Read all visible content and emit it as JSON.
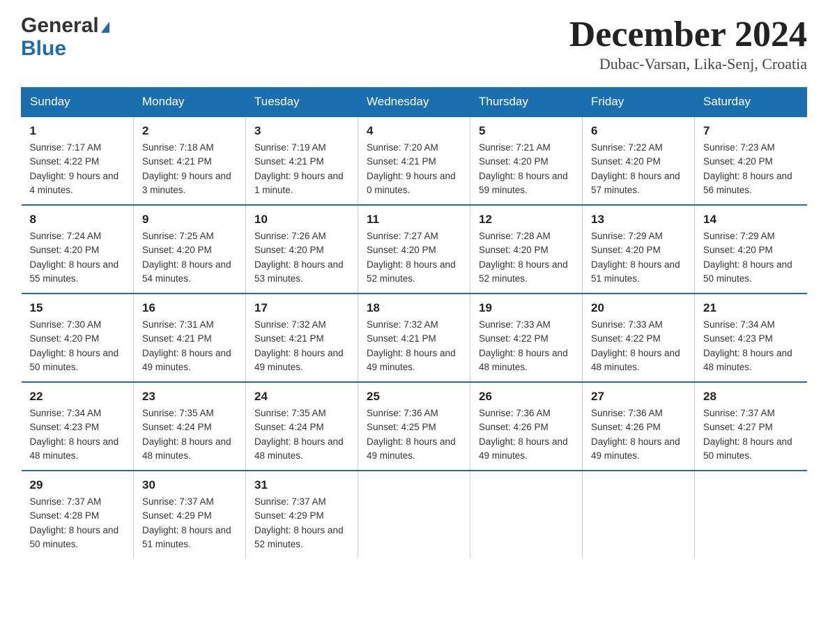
{
  "header": {
    "logo_general": "General",
    "logo_blue": "Blue",
    "title": "December 2024",
    "subtitle": "Dubac-Varsan, Lika-Senj, Croatia"
  },
  "days_of_week": [
    "Sunday",
    "Monday",
    "Tuesday",
    "Wednesday",
    "Thursday",
    "Friday",
    "Saturday"
  ],
  "weeks": [
    [
      {
        "day": "1",
        "sunrise": "7:17 AM",
        "sunset": "4:22 PM",
        "daylight": "9 hours and 4 minutes."
      },
      {
        "day": "2",
        "sunrise": "7:18 AM",
        "sunset": "4:21 PM",
        "daylight": "9 hours and 3 minutes."
      },
      {
        "day": "3",
        "sunrise": "7:19 AM",
        "sunset": "4:21 PM",
        "daylight": "9 hours and 1 minute."
      },
      {
        "day": "4",
        "sunrise": "7:20 AM",
        "sunset": "4:21 PM",
        "daylight": "9 hours and 0 minutes."
      },
      {
        "day": "5",
        "sunrise": "7:21 AM",
        "sunset": "4:20 PM",
        "daylight": "8 hours and 59 minutes."
      },
      {
        "day": "6",
        "sunrise": "7:22 AM",
        "sunset": "4:20 PM",
        "daylight": "8 hours and 57 minutes."
      },
      {
        "day": "7",
        "sunrise": "7:23 AM",
        "sunset": "4:20 PM",
        "daylight": "8 hours and 56 minutes."
      }
    ],
    [
      {
        "day": "8",
        "sunrise": "7:24 AM",
        "sunset": "4:20 PM",
        "daylight": "8 hours and 55 minutes."
      },
      {
        "day": "9",
        "sunrise": "7:25 AM",
        "sunset": "4:20 PM",
        "daylight": "8 hours and 54 minutes."
      },
      {
        "day": "10",
        "sunrise": "7:26 AM",
        "sunset": "4:20 PM",
        "daylight": "8 hours and 53 minutes."
      },
      {
        "day": "11",
        "sunrise": "7:27 AM",
        "sunset": "4:20 PM",
        "daylight": "8 hours and 52 minutes."
      },
      {
        "day": "12",
        "sunrise": "7:28 AM",
        "sunset": "4:20 PM",
        "daylight": "8 hours and 52 minutes."
      },
      {
        "day": "13",
        "sunrise": "7:29 AM",
        "sunset": "4:20 PM",
        "daylight": "8 hours and 51 minutes."
      },
      {
        "day": "14",
        "sunrise": "7:29 AM",
        "sunset": "4:20 PM",
        "daylight": "8 hours and 50 minutes."
      }
    ],
    [
      {
        "day": "15",
        "sunrise": "7:30 AM",
        "sunset": "4:20 PM",
        "daylight": "8 hours and 50 minutes."
      },
      {
        "day": "16",
        "sunrise": "7:31 AM",
        "sunset": "4:21 PM",
        "daylight": "8 hours and 49 minutes."
      },
      {
        "day": "17",
        "sunrise": "7:32 AM",
        "sunset": "4:21 PM",
        "daylight": "8 hours and 49 minutes."
      },
      {
        "day": "18",
        "sunrise": "7:32 AM",
        "sunset": "4:21 PM",
        "daylight": "8 hours and 49 minutes."
      },
      {
        "day": "19",
        "sunrise": "7:33 AM",
        "sunset": "4:22 PM",
        "daylight": "8 hours and 48 minutes."
      },
      {
        "day": "20",
        "sunrise": "7:33 AM",
        "sunset": "4:22 PM",
        "daylight": "8 hours and 48 minutes."
      },
      {
        "day": "21",
        "sunrise": "7:34 AM",
        "sunset": "4:23 PM",
        "daylight": "8 hours and 48 minutes."
      }
    ],
    [
      {
        "day": "22",
        "sunrise": "7:34 AM",
        "sunset": "4:23 PM",
        "daylight": "8 hours and 48 minutes."
      },
      {
        "day": "23",
        "sunrise": "7:35 AM",
        "sunset": "4:24 PM",
        "daylight": "8 hours and 48 minutes."
      },
      {
        "day": "24",
        "sunrise": "7:35 AM",
        "sunset": "4:24 PM",
        "daylight": "8 hours and 48 minutes."
      },
      {
        "day": "25",
        "sunrise": "7:36 AM",
        "sunset": "4:25 PM",
        "daylight": "8 hours and 49 minutes."
      },
      {
        "day": "26",
        "sunrise": "7:36 AM",
        "sunset": "4:26 PM",
        "daylight": "8 hours and 49 minutes."
      },
      {
        "day": "27",
        "sunrise": "7:36 AM",
        "sunset": "4:26 PM",
        "daylight": "8 hours and 49 minutes."
      },
      {
        "day": "28",
        "sunrise": "7:37 AM",
        "sunset": "4:27 PM",
        "daylight": "8 hours and 50 minutes."
      }
    ],
    [
      {
        "day": "29",
        "sunrise": "7:37 AM",
        "sunset": "4:28 PM",
        "daylight": "8 hours and 50 minutes."
      },
      {
        "day": "30",
        "sunrise": "7:37 AM",
        "sunset": "4:29 PM",
        "daylight": "8 hours and 51 minutes."
      },
      {
        "day": "31",
        "sunrise": "7:37 AM",
        "sunset": "4:29 PM",
        "daylight": "8 hours and 52 minutes."
      },
      null,
      null,
      null,
      null
    ]
  ]
}
